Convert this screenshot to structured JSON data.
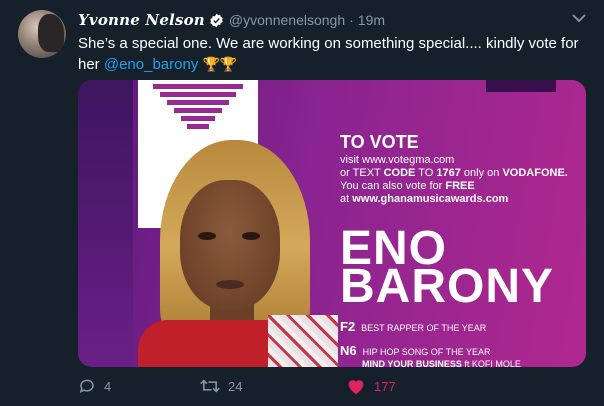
{
  "tweet": {
    "display_name": "Yvonne Nelson",
    "handle": "@yvonnenelsongh",
    "separator": "·",
    "time": "19m",
    "text_main": "She’s a special one. We are working on something special.... kindly vote for her ",
    "mention": "@eno_barony",
    "trophies": "🏆🏆"
  },
  "media": {
    "vote_title": "TO VOTE",
    "line1": "visit www.votegma.com",
    "line2_pre": "or TEXT ",
    "line2_code": "CODE",
    "line2_mid": " TO ",
    "line2_num": "1767",
    "line2_post": " only on ",
    "line2_net": "VODAFONE.",
    "line3_pre": "You can also vote for ",
    "line3_free": "FREE",
    "line4_pre": "at ",
    "line4_site": "www.ghanamusicawards.com",
    "name_line1": "ENO",
    "name_line2": "BARONY",
    "cat1_code": "F2",
    "cat1_label": "BEST RAPPER OF THE YEAR",
    "cat2_code": "N6",
    "cat2_label": "HIP HOP SONG OF THE YEAR",
    "cat2_sub": "MIND YOUR BUSINESS",
    "cat2_ft": " ft KOFI MOLE"
  },
  "actions": {
    "reply_count": "4",
    "retweet_count": "24",
    "like_count": "177"
  },
  "colors": {
    "background": "#15202b",
    "link": "#1da1f2",
    "muted": "#8899a6",
    "like": "#e0245e"
  },
  "icons": [
    "verified-icon",
    "chevron-down-icon",
    "reply-icon",
    "retweet-icon",
    "heart-icon"
  ]
}
